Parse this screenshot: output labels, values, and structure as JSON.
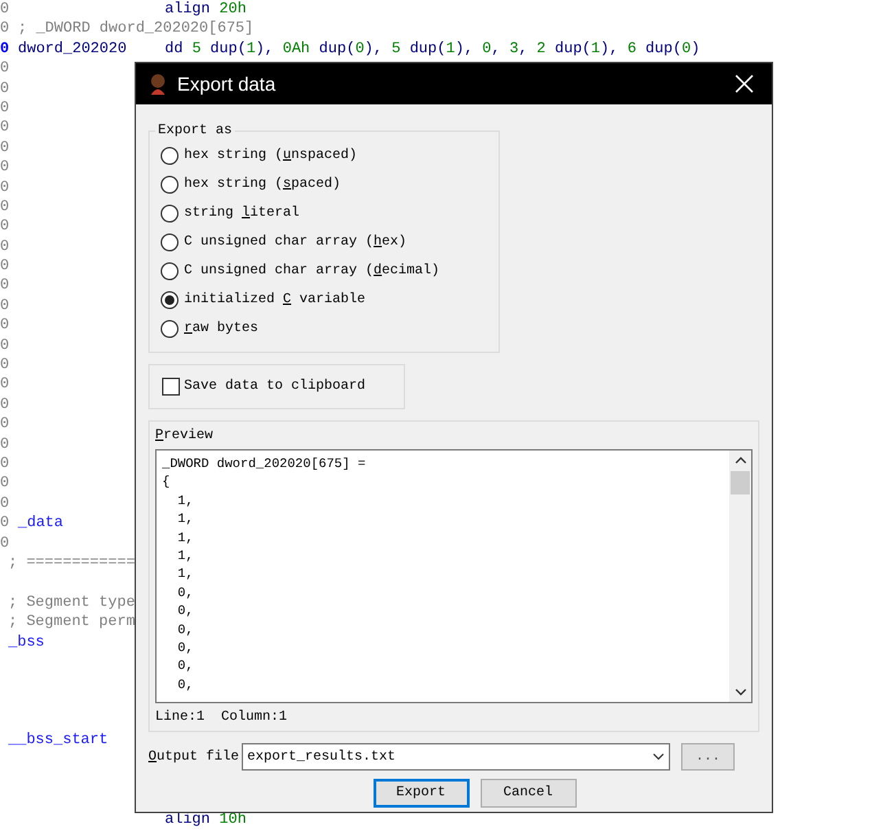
{
  "code_lines": [
    {
      "gutter": {
        "text": "0",
        "current": false
      },
      "instruction": [
        {
          "text": "align",
          "kind": "keyword"
        },
        {
          "text": " 20h",
          "kind": "number"
        }
      ]
    },
    {
      "gutter": {
        "text": "0",
        "current": false
      },
      "comment": "; _DWORD dword_202020[675]"
    },
    {
      "gutter": {
        "text": "0",
        "current": true
      },
      "label": {
        "text": "dword_202020",
        "kind": "name"
      },
      "instruction": [
        {
          "text": "dd ",
          "kind": "keyword"
        },
        {
          "text": "5",
          "kind": "number"
        },
        {
          "text": " dup(",
          "kind": "keyword"
        },
        {
          "text": "1",
          "kind": "number"
        },
        {
          "text": "), ",
          "kind": "keyword"
        },
        {
          "text": "0Ah",
          "kind": "number"
        },
        {
          "text": " dup(",
          "kind": "keyword"
        },
        {
          "text": "0",
          "kind": "number"
        },
        {
          "text": "), ",
          "kind": "keyword"
        },
        {
          "text": "5",
          "kind": "number"
        },
        {
          "text": " dup(",
          "kind": "keyword"
        },
        {
          "text": "1",
          "kind": "number"
        },
        {
          "text": "), ",
          "kind": "keyword"
        },
        {
          "text": "0",
          "kind": "number"
        },
        {
          "text": ", ",
          "kind": "keyword"
        },
        {
          "text": "3",
          "kind": "number"
        },
        {
          "text": ", ",
          "kind": "keyword"
        },
        {
          "text": "2",
          "kind": "number"
        },
        {
          "text": " dup(",
          "kind": "keyword"
        },
        {
          "text": "1",
          "kind": "number"
        },
        {
          "text": "), ",
          "kind": "keyword"
        },
        {
          "text": "6",
          "kind": "number"
        },
        {
          "text": " dup(",
          "kind": "keyword"
        },
        {
          "text": "0",
          "kind": "number"
        },
        {
          "text": ")",
          "kind": "keyword"
        }
      ]
    },
    {
      "gutter": {
        "text": "0",
        "current": false
      }
    },
    {
      "gutter": {
        "text": "0",
        "current": false
      }
    },
    {
      "gutter": {
        "text": "0",
        "current": false
      }
    },
    {
      "gutter": {
        "text": "0",
        "current": false
      }
    },
    {
      "gutter": {
        "text": "0",
        "current": false
      }
    },
    {
      "gutter": {
        "text": "0",
        "current": false
      }
    },
    {
      "gutter": {
        "text": "0",
        "current": false
      }
    },
    {
      "gutter": {
        "text": "0",
        "current": false
      }
    },
    {
      "gutter": {
        "text": "0",
        "current": false
      }
    },
    {
      "gutter": {
        "text": "0",
        "current": false
      }
    },
    {
      "gutter": {
        "text": "0",
        "current": false
      }
    },
    {
      "gutter": {
        "text": "0",
        "current": false
      }
    },
    {
      "gutter": {
        "text": "0",
        "current": false
      }
    },
    {
      "gutter": {
        "text": "0",
        "current": false
      }
    },
    {
      "gutter": {
        "text": "0",
        "current": false
      }
    },
    {
      "gutter": {
        "text": "0",
        "current": false
      }
    },
    {
      "gutter": {
        "text": "0",
        "current": false
      }
    },
    {
      "gutter": {
        "text": "0",
        "current": false
      }
    },
    {
      "gutter": {
        "text": "0",
        "current": false
      }
    },
    {
      "gutter": {
        "text": "0",
        "current": false
      }
    },
    {
      "gutter": {
        "text": "0",
        "current": false
      }
    },
    {
      "gutter": {
        "text": "0",
        "current": false
      }
    },
    {
      "gutter": {
        "text": "0",
        "current": false
      }
    },
    {
      "gutter": {
        "text": "0",
        "current": false
      },
      "label": {
        "text": "_data",
        "kind": "segment"
      }
    },
    {
      "gutter": {
        "text": "0",
        "current": false
      }
    },
    {
      "comment": "; ============"
    },
    {
      "kind": "blank"
    },
    {
      "comment": "; Segment type"
    },
    {
      "comment": "; Segment perm"
    },
    {
      "label": {
        "text": "_bss",
        "kind": "segment"
      }
    },
    {
      "kind": "blank"
    },
    {
      "kind": "blank"
    },
    {
      "kind": "blank"
    },
    {
      "kind": "blank"
    },
    {
      "label": {
        "text": "__bss_start",
        "kind": "segment"
      }
    },
    {
      "kind": "blank"
    },
    {
      "kind": "blank"
    },
    {
      "kind": "blank"
    },
    {
      "instruction": [
        {
          "text": "align",
          "kind": "keyword"
        },
        {
          "text": " 10h",
          "kind": "number"
        }
      ]
    }
  ],
  "dialog": {
    "title": "Export data",
    "export_as": {
      "title": "Export as",
      "options": [
        {
          "label": {
            "pre": "hex string (",
            "key": "u",
            "post": "nspaced)"
          },
          "selected": false
        },
        {
          "label": {
            "pre": "hex string (",
            "key": "s",
            "post": "paced)"
          },
          "selected": false
        },
        {
          "label": {
            "pre": "string ",
            "key": "l",
            "post": "iteral"
          },
          "selected": false
        },
        {
          "label": {
            "pre": "C unsigned char array (",
            "key": "h",
            "post": "ex)"
          },
          "selected": false
        },
        {
          "label": {
            "pre": "C unsigned char array (",
            "key": "d",
            "post": "ecimal)"
          },
          "selected": false
        },
        {
          "label": {
            "pre": "initialized ",
            "key": "C",
            "post": " variable"
          },
          "selected": true
        },
        {
          "label": {
            "key": "r",
            "post": "aw bytes"
          },
          "selected": false
        }
      ]
    },
    "clipboard": {
      "label": "Save data to clipboard",
      "checked": false
    },
    "preview": {
      "title": {
        "key": "P",
        "post": "review"
      },
      "lines": [
        "_DWORD dword_202020[675] =",
        "{",
        "  1,",
        "  1,",
        "  1,",
        "  1,",
        "  1,",
        "  0,",
        "  0,",
        "  0,",
        "  0,",
        "  0,",
        "  0,"
      ],
      "status": "Line:1  Column:1"
    },
    "output_file": {
      "label": {
        "key": "O",
        "post": "utput file"
      },
      "value": "export_results.txt",
      "browse": "..."
    },
    "buttons": [
      {
        "label": "Export",
        "default": true
      },
      {
        "label": "Cancel",
        "default": false
      }
    ]
  }
}
